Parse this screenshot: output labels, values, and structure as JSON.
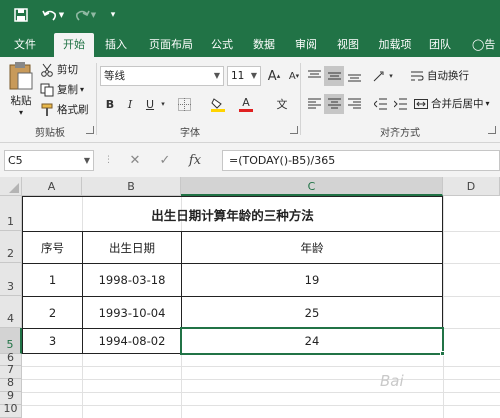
{
  "qat": {
    "save_icon": "save-icon",
    "undo_icon": "undo-icon",
    "redo_icon": "redo-icon",
    "customize_icon": "customize-qat-icon"
  },
  "tabs": [
    "文件",
    "开始",
    "插入",
    "页面布局",
    "公式",
    "数据",
    "审阅",
    "视图",
    "加载项",
    "团队",
    "告"
  ],
  "active_tab": "开始",
  "clipboard": {
    "paste": "粘贴",
    "cut": "剪切",
    "copy": "复制",
    "format_painter": "格式刷",
    "label": "剪贴板"
  },
  "font": {
    "name": "等线",
    "size": "11",
    "bold": "B",
    "italic": "I",
    "underline": "U",
    "label": "字体",
    "font_color": "A",
    "phonetic": "文"
  },
  "alignment": {
    "wrap_text": "自动换行",
    "merge_center": "合并后居中",
    "label": "对齐方式"
  },
  "formula_bar": {
    "name_box": "C5",
    "formula": "=(TODAY()-B5)/365",
    "cancel": "✕",
    "confirm": "✓",
    "fx": "fx"
  },
  "columns": [
    "A",
    "B",
    "C",
    "D"
  ],
  "rows": [
    "1",
    "2",
    "3",
    "4",
    "5",
    "6",
    "7",
    "8",
    "9",
    "10"
  ],
  "sheet": {
    "title": "出生日期计算年龄的三种方法",
    "headers": [
      "序号",
      "出生日期",
      "年龄"
    ],
    "data": [
      [
        "1",
        "1998-03-18",
        "19"
      ],
      [
        "2",
        "1993-10-04",
        "25"
      ],
      [
        "3",
        "1994-08-02",
        "24"
      ]
    ]
  },
  "watermark": "Bai"
}
